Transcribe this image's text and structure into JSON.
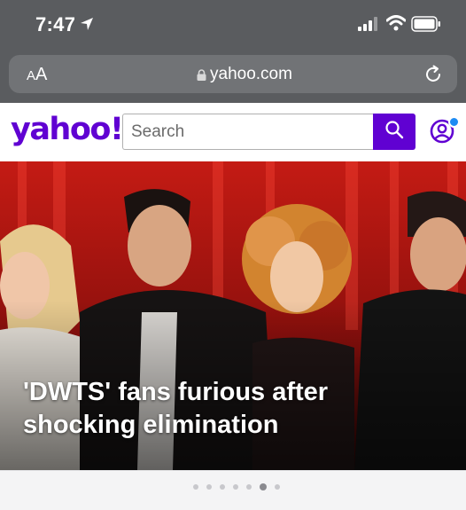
{
  "status_bar": {
    "time": "7:47",
    "icons": [
      "location-arrow-icon",
      "cellular-signal-icon",
      "wifi-icon",
      "battery-icon"
    ]
  },
  "browser": {
    "text_size_label_small": "A",
    "text_size_label_large": "A",
    "url": "yahoo.com",
    "icons": [
      "lock-icon",
      "reload-icon"
    ]
  },
  "header": {
    "logo": "yahoo!",
    "search_placeholder": "Search",
    "brand_color": "#6001d2",
    "notification_color": "#1d8bf3",
    "icons": [
      "search-icon",
      "profile-icon"
    ]
  },
  "hero": {
    "headline_line1": "'DWTS' fans furious after",
    "headline_line2": "shocking elimination"
  },
  "pager": {
    "total": 7,
    "active_index": 5
  }
}
